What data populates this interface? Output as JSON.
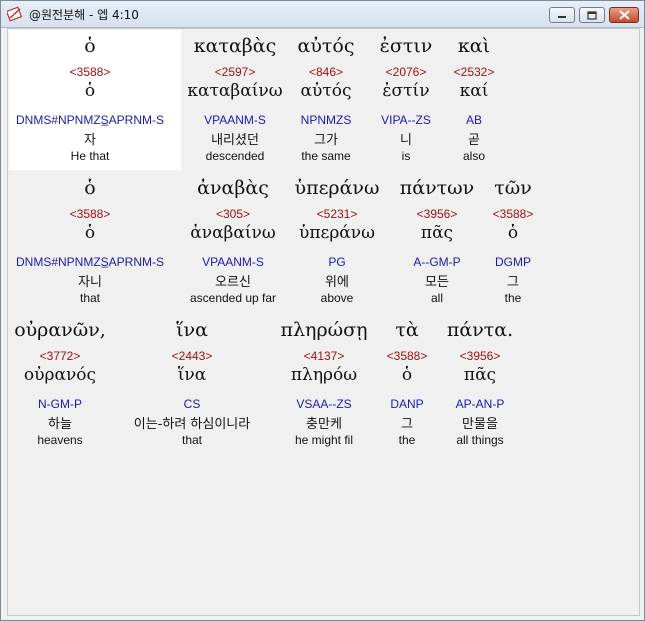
{
  "window": {
    "title": "@원전분해 - 엡 4:10",
    "accent": "#a01010",
    "parse_color": "#1a1ab0"
  },
  "rows": [
    [
      {
        "greek": "ὁ",
        "strong": "<3588>",
        "lemma": "ὁ",
        "parse": "DNMS#NPNMZS̲APRNM-S",
        "korean": "자",
        "english": "He that"
      },
      {
        "greek": "καταβὰς",
        "strong": "<2597>",
        "lemma": "καταβαίνω",
        "parse": "VPAANM-S",
        "korean": "내리셨던",
        "english": "descended"
      },
      {
        "greek": "αὐτός",
        "strong": "<846>",
        "lemma": "αὐτός",
        "parse": "NPNMZS",
        "korean": "그가",
        "english": "the same"
      },
      {
        "greek": "ἐστιν",
        "strong": "<2076>",
        "lemma": "ἐστίν",
        "parse": "VIPA--ZS",
        "korean": "니",
        "english": "is"
      },
      {
        "greek": "καὶ",
        "strong": "<2532>",
        "lemma": "καί",
        "parse": "AB",
        "korean": "곧",
        "english": "also"
      }
    ],
    [
      {
        "greek": "ὁ",
        "strong": "<3588>",
        "lemma": "ὁ",
        "parse": "DNMS#NPNMZS̲APRNM-S",
        "korean": "자니",
        "english": "that"
      },
      {
        "greek": "ἀναβὰς",
        "strong": "<305>",
        "lemma": "ἀναβαίνω",
        "parse": "VPAANM-S",
        "korean": "오르신",
        "english": "ascended up far"
      },
      {
        "greek": "ὑπεράνω",
        "strong": "<5231>",
        "lemma": "ὑπεράνω",
        "parse": "PG",
        "korean": "위에",
        "english": "above"
      },
      {
        "greek": "πάντων",
        "strong": "<3956>",
        "lemma": "πᾶς",
        "parse": "A--GM-P",
        "korean": "모든",
        "english": "all"
      },
      {
        "greek": "τῶν",
        "strong": "<3588>",
        "lemma": "ὁ",
        "parse": "DGMP",
        "korean": "그",
        "english": "the"
      }
    ],
    [
      {
        "greek": "οὐρανῶν,",
        "strong": "<3772>",
        "lemma": "οὐρανός",
        "parse": "N-GM-P",
        "korean": "하늘",
        "english": "heavens"
      },
      {
        "greek": "ἵνα",
        "strong": "<2443>",
        "lemma": "ἵνα",
        "parse": "CS",
        "korean": "이는-하려 하심이니라",
        "english": "that"
      },
      {
        "greek": "πληρώσῃ",
        "strong": "<4137>",
        "lemma": "πληρόω",
        "parse": "VSAA--ZS",
        "korean": "충만케",
        "english": "he might fil"
      },
      {
        "greek": "τὰ",
        "strong": "<3588>",
        "lemma": "ὁ",
        "parse": "DANP",
        "korean": "그",
        "english": "the"
      },
      {
        "greek": "πάντα.",
        "strong": "<3956>",
        "lemma": "πᾶς",
        "parse": "AP-AN-P",
        "korean": "만물을",
        "english": "all things"
      }
    ]
  ]
}
